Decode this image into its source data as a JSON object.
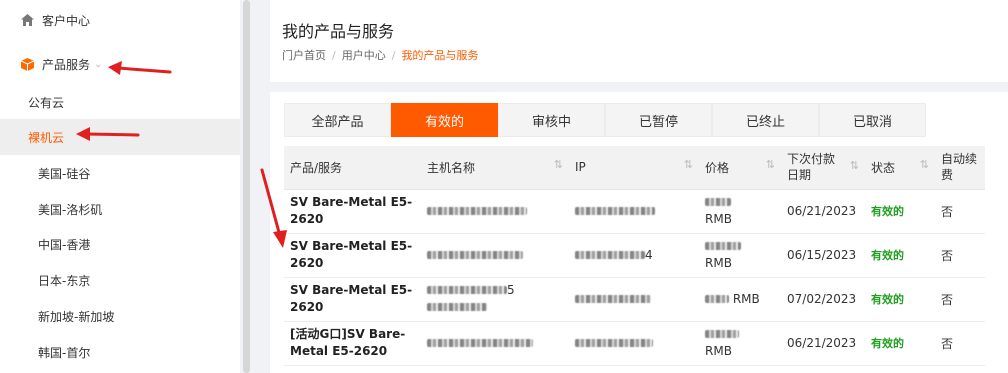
{
  "sidebar": {
    "items": [
      {
        "label": "客户中心",
        "icon": "home-icon"
      },
      {
        "label": "产品服务",
        "icon": "box-icon"
      },
      {
        "label": "公有云"
      },
      {
        "label": "裸机云"
      },
      {
        "label": "美国-硅谷"
      },
      {
        "label": "美国-洛杉矶"
      },
      {
        "label": "中国-香港"
      },
      {
        "label": "日本-东京"
      },
      {
        "label": "新加坡-新加坡"
      },
      {
        "label": "韩国-首尔"
      }
    ]
  },
  "header": {
    "title": "我的产品与服务",
    "breadcrumb": [
      "门户首页",
      "用户中心",
      "我的产品与服务"
    ],
    "separator": "/"
  },
  "tabs": [
    "全部产品",
    "有效的",
    "审核中",
    "已暂停",
    "已终止",
    "已取消"
  ],
  "table": {
    "columns": [
      "产品/服务",
      "主机名称",
      "IP",
      "价格",
      "下次付款日期",
      "状态",
      "自动续费"
    ],
    "column_lines": {
      "next_payment": [
        "下次付款",
        "日期"
      ],
      "auto_renew": [
        "自动续",
        "费"
      ]
    },
    "rows": [
      {
        "product": [
          "SV Bare-Metal E5-",
          "2620"
        ],
        "price_unit": "RMB",
        "date": "06/21/2023",
        "status": "有效的",
        "renew": "否"
      },
      {
        "product": [
          "SV Bare-Metal E5-",
          "2620"
        ],
        "ip_suffix": "4",
        "price_unit": "RMB",
        "date": "06/15/2023",
        "status": "有效的",
        "renew": "否"
      },
      {
        "product": [
          "SV Bare-Metal E5-",
          "2620"
        ],
        "host_suffix": "5",
        "price_unit": "RMB",
        "date": "07/02/2023",
        "status": "有效的",
        "renew": "否"
      },
      {
        "product": [
          "[活动G口]SV Bare-",
          "Metal E5-2620"
        ],
        "price_unit": "RMB",
        "date": "06/21/2023",
        "status": "有效的",
        "renew": "否"
      }
    ]
  },
  "colors": {
    "accent": "#ff5a00",
    "status_green": "#1e9e1e",
    "annotation_red": "#e02020"
  }
}
